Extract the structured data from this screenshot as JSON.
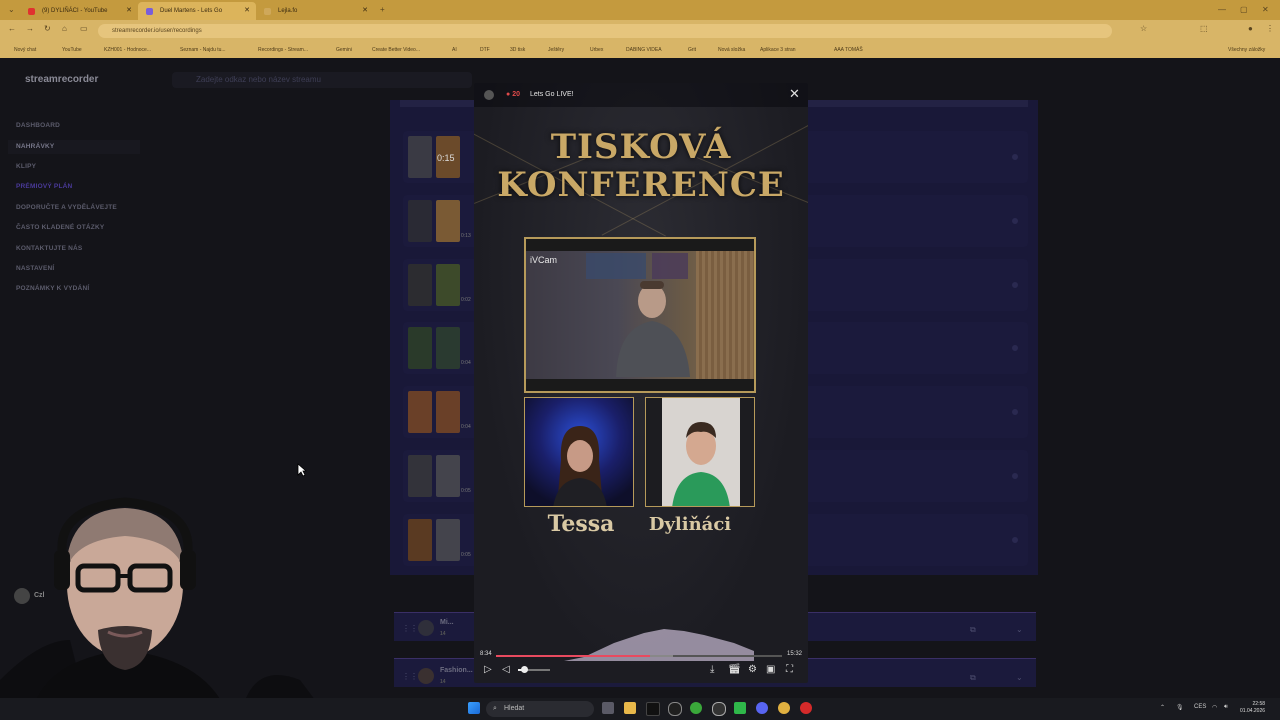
{
  "browser": {
    "tabs": [
      {
        "title": "(9) DYLIŇÁCI - YouTube",
        "fav_color": "#e0322f",
        "active": false
      },
      {
        "title": "Duel Martens - Lets Go",
        "fav_color": "#7a5fd9",
        "active": true
      },
      {
        "title": "Lejla.fo",
        "fav_color": "#cfa85a",
        "active": false
      }
    ],
    "url": "streamrecorder.io/user/recordings",
    "bookmarks": [
      "Nový chat",
      "YouTube",
      "KZH001 - Hodnoce...",
      "Seznam - Najdu tu...",
      "Recordings - Stream...",
      "Gemini",
      "Create Better Video...",
      "AI",
      "DTF",
      "3D tisk",
      "Ještěry",
      "Urbex",
      "DABING VIDEA",
      "Grit",
      "Nová složka",
      "Aplikace 3 stran",
      "AAA TOMÁŠ",
      "Všechny záložky"
    ]
  },
  "app": {
    "logo": "streamrecorder",
    "search_placeholder": "Zadejte odkaz nebo název streamu",
    "menu": [
      {
        "label": "DASHBOARD",
        "key": "dashboard"
      },
      {
        "label": "NAHRÁVKY",
        "key": "nahravky",
        "selected": true
      },
      {
        "label": "KLIPY",
        "key": "klipy"
      },
      {
        "label": "PRÉMIOVÝ PLÁN",
        "key": "premium",
        "premium": true
      },
      {
        "label": "DOPORUČTE A VYDĚLÁVEJTE",
        "key": "doporucte"
      },
      {
        "label": "ČASTO KLADENÉ OTÁZKY",
        "key": "faq"
      },
      {
        "label": "KONTAKTUJTE NÁS",
        "key": "kontakt"
      },
      {
        "label": "NASTAVENÍ",
        "key": "nastaveni"
      },
      {
        "label": "POZNÁMKY K VYDÁNÍ",
        "key": "poznamky"
      }
    ],
    "thumb_times": [
      "0:15",
      "0:13",
      "0:02",
      "0:04",
      "0:04",
      "0:05",
      "0:05"
    ],
    "collapsed_streams": [
      {
        "name": "Mi...",
        "sub": "14"
      },
      {
        "name": "Fashion...",
        "sub": "14"
      }
    ],
    "user_initial": "Czl"
  },
  "player": {
    "viewers": "20",
    "title": "Lets Go LIVE!",
    "overlay_title_1": "TISKOVÁ",
    "overlay_title_2": "KONFERENCE",
    "cam_label": "iVCam",
    "guest_1": "Tessa",
    "guest_2": "Dyliňáci",
    "time_current": "8:34",
    "time_total": "15:32",
    "progress": 0.54,
    "buffered": 0.62,
    "volume": 0.18
  },
  "taskbar": {
    "search_label": "Hledat",
    "lang": "CES",
    "time": "22:58",
    "date": "01.04.2026"
  },
  "colors": {
    "accent": "#e84a5f",
    "gold": "#c9a866",
    "panel": "#191838"
  }
}
